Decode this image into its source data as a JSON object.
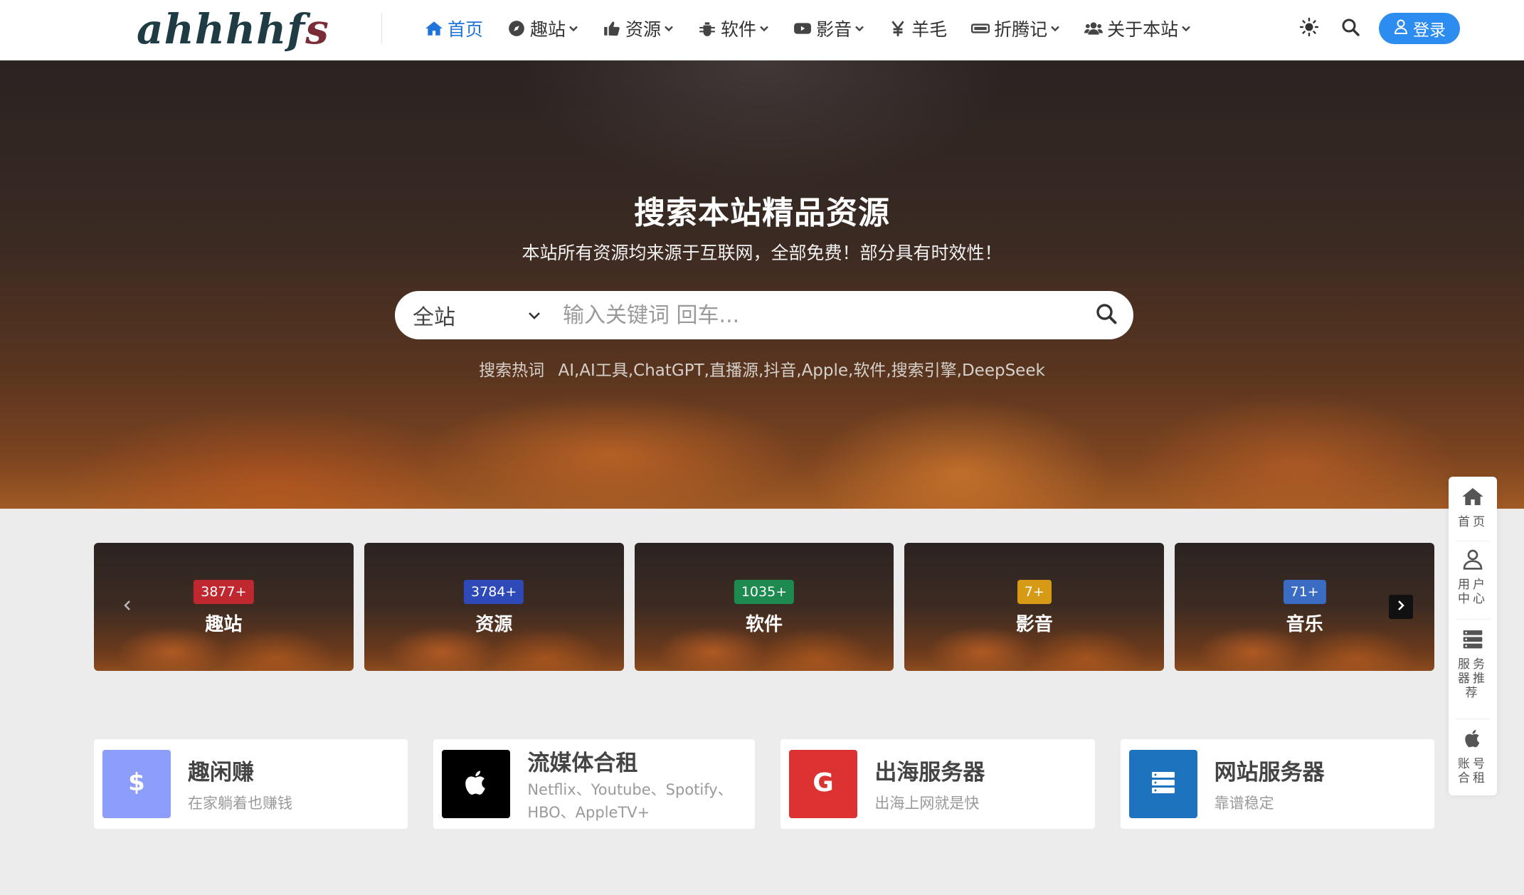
{
  "header": {
    "logo_main": "ahhhhf",
    "logo_tail": "s",
    "nav": [
      {
        "label": "首页",
        "icon": "home-icon",
        "active": true,
        "dropdown": false
      },
      {
        "label": "趣站",
        "icon": "compass-icon",
        "active": false,
        "dropdown": true
      },
      {
        "label": "资源",
        "icon": "thumbs-up-icon",
        "active": false,
        "dropdown": true
      },
      {
        "label": "软件",
        "icon": "bug-icon",
        "active": false,
        "dropdown": true
      },
      {
        "label": "影音",
        "icon": "youtube-icon",
        "active": false,
        "dropdown": true
      },
      {
        "label": "羊毛",
        "icon": "yen-icon",
        "active": false,
        "dropdown": false
      },
      {
        "label": "折腾记",
        "icon": "keyboard-icon",
        "active": false,
        "dropdown": true
      },
      {
        "label": "关于本站",
        "icon": "users-icon",
        "active": false,
        "dropdown": true
      }
    ],
    "login_label": "登录"
  },
  "hero": {
    "title": "搜索本站精品资源",
    "subtitle": "本站所有资源均来源于互联网，全部免费！部分具有时效性！",
    "search_scope": "全站",
    "search_placeholder": "输入关键词 回车...",
    "hot_label": "搜索热词",
    "hot_words": "AI,AI工具,ChatGPT,直播源,抖音,Apple,软件,搜索引擎,DeepSeek"
  },
  "categories": [
    {
      "name": "趣站",
      "count": "3877+",
      "color": "#c0282f"
    },
    {
      "name": "资源",
      "count": "3784+",
      "color": "#2e4ab8"
    },
    {
      "name": "软件",
      "count": "1035+",
      "color": "#1d8a4f"
    },
    {
      "name": "影音",
      "count": "7+",
      "color": "#d79a14"
    },
    {
      "name": "音乐",
      "count": "71+",
      "color": "#3b6cc4"
    }
  ],
  "features": [
    {
      "title": "趣闲赚",
      "desc": "在家躺着也赚钱",
      "icon": "dollar-icon",
      "bg": "#8c9dfa"
    },
    {
      "title": "流媒体合租",
      "desc": "Netflix、Youtube、Spotify、HBO、AppleTV+",
      "icon": "apple-icon",
      "bg": "#000000"
    },
    {
      "title": "出海服务器",
      "desc": "出海上网就是快",
      "icon": "google-icon",
      "bg": "#dc3232"
    },
    {
      "title": "网站服务器",
      "desc": "靠谱稳定",
      "icon": "server-icon",
      "bg": "#1e73be"
    }
  ],
  "floatbar": [
    {
      "label": "首页",
      "icon": "home-icon"
    },
    {
      "label": "用户中心",
      "icon": "user-icon"
    },
    {
      "label": "服务器推荐",
      "icon": "server-icon"
    },
    {
      "label": "账号合租",
      "icon": "apple-icon"
    }
  ]
}
